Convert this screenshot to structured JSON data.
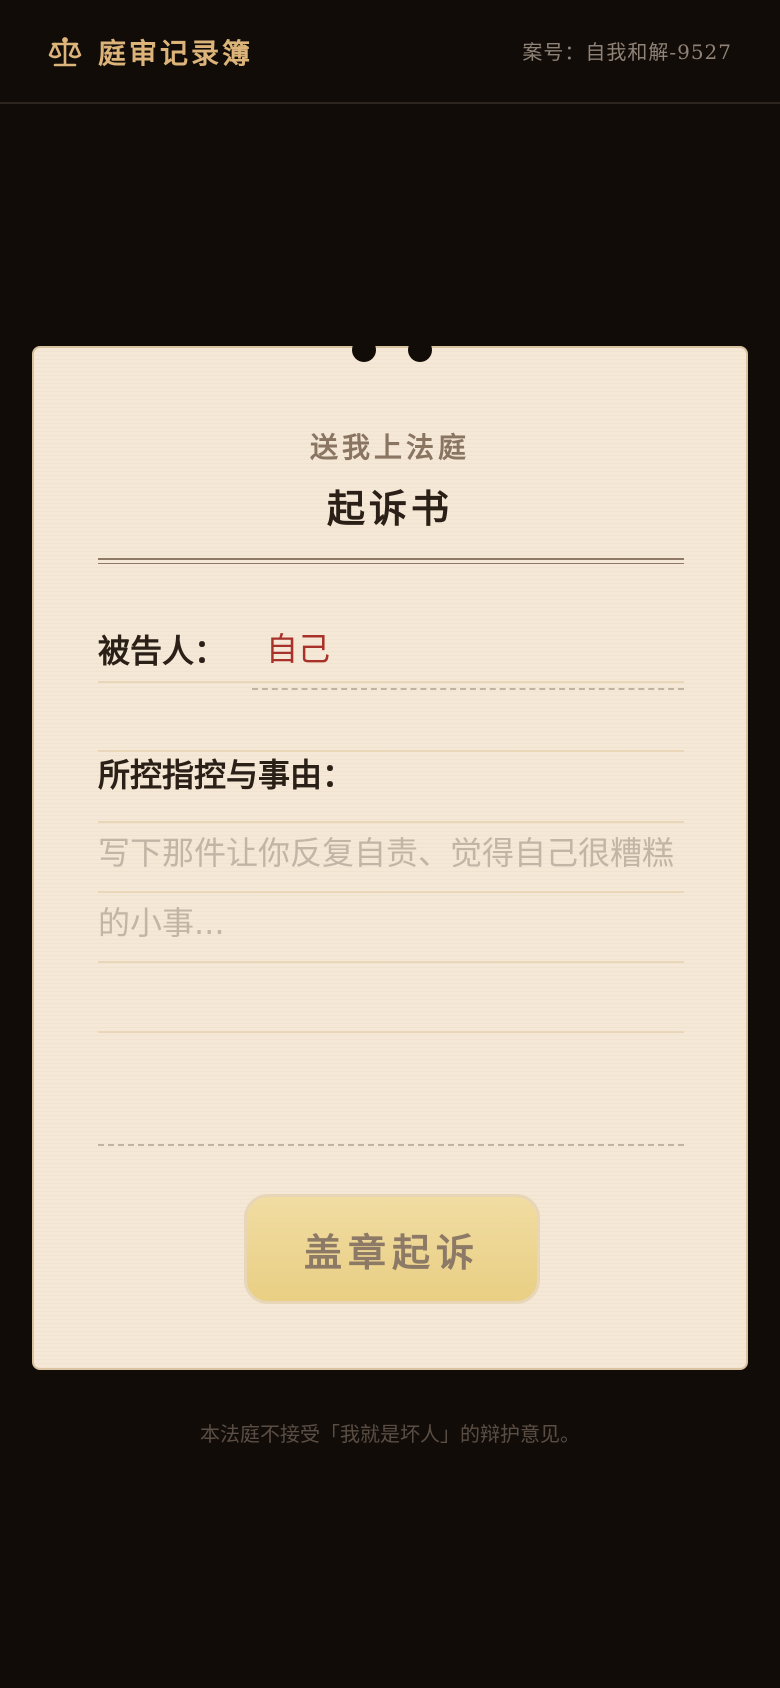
{
  "header": {
    "app_title": "庭审记录簿",
    "case_number": "案号：自我和解-9527",
    "icon": "scales-icon",
    "accent_color": "#dcb47a"
  },
  "document": {
    "court_title": "送我上法庭",
    "doc_title": "起诉书",
    "defendant_label": "被告人：",
    "defendant_value": "自己",
    "charges_label": "所控指控与事由：",
    "charges_value": "",
    "charges_placeholder": "写下那件让你反复自责、觉得自己很糟糕的小事...",
    "submit_label": "盖章起诉"
  },
  "footer": {
    "note": "本法庭不接受「我就是坏人」的辩护意见。"
  },
  "colors": {
    "background": "#120c09",
    "paper": "#f5e8d6",
    "defendant_value": "#a8322a",
    "button": "#e9cf84"
  }
}
